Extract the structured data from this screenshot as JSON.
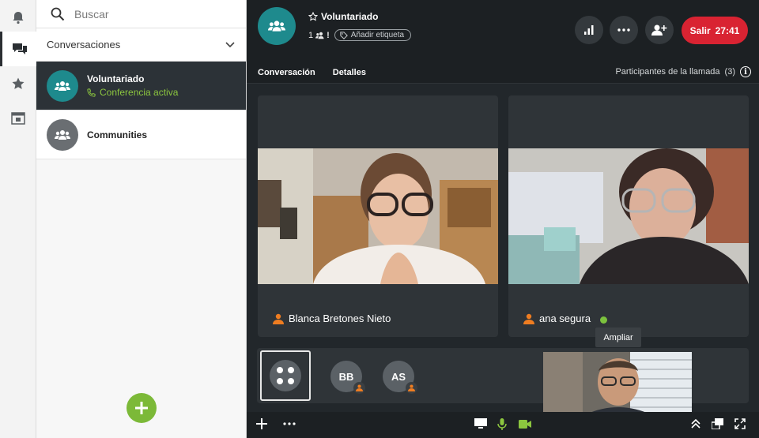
{
  "search": {
    "placeholder": "Buscar"
  },
  "sidebar": {
    "section_title": "Conversaciones",
    "conversations": [
      {
        "name": "Voluntariado",
        "status": "Conferencia activa"
      },
      {
        "name": "Communities",
        "status": ""
      }
    ]
  },
  "header": {
    "title": "Voluntariado",
    "member_count": "1",
    "member_flag": "!",
    "tag_label": "Añadir etiqueta",
    "exit_label": "Salir",
    "timer": "27:41"
  },
  "tabs": [
    {
      "label": "Conversación"
    },
    {
      "label": "Detalles"
    }
  ],
  "call": {
    "participants_label": "Participantes de la llamada",
    "participants_count": "(3)",
    "tiles": [
      {
        "name": "Blanca Bretones Nieto"
      },
      {
        "name": "ana segura"
      }
    ],
    "strip": [
      {
        "initials": "BB"
      },
      {
        "initials": "AS"
      }
    ],
    "tooltip": "Ampliar"
  },
  "colors": {
    "accent_teal": "#1e8a8d",
    "exit_red": "#d92332",
    "active_green": "#8cc63f",
    "dark_bg": "#22272b"
  }
}
